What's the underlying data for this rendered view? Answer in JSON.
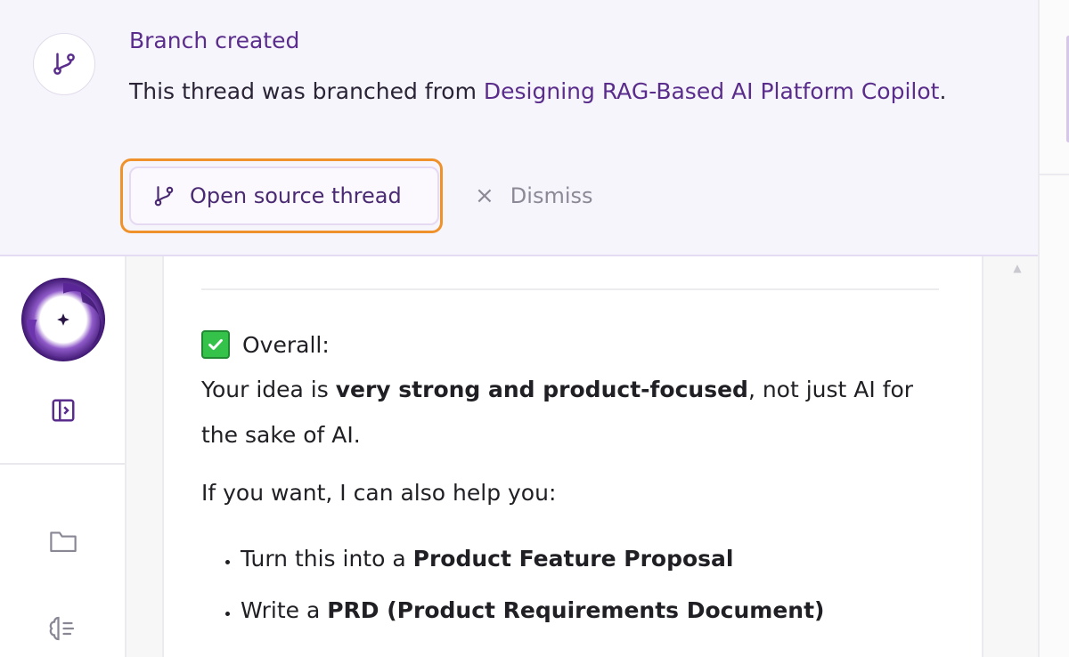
{
  "banner": {
    "title": "Branch created",
    "text_prefix": "This thread was branched from ",
    "source_thread": "Designing RAG-Based AI Platform Copilot",
    "text_suffix": ".",
    "open_button_label": "Open source thread",
    "dismiss_label": "Dismiss",
    "dismiss_icon": "×"
  },
  "sidebar": {
    "icons": [
      "branch-logo",
      "sidebar-toggle-icon",
      "folder-icon",
      "brain-icon"
    ]
  },
  "message": {
    "overall_label": "Overall:",
    "p1_prefix": "Your idea is ",
    "p1_bold": "very strong and product-focused",
    "p1_suffix": ", not just AI for the sake of AI.",
    "p2": "If you want, I can also help you:",
    "bullets": [
      {
        "prefix": "Turn this into a ",
        "bold": "Product Feature Proposal"
      },
      {
        "prefix": "Write a ",
        "bold": "PRD (Product Requirements Document)"
      }
    ]
  },
  "colors": {
    "accent_purple": "#5a2d8c",
    "focus_orange": "#f0922b",
    "check_green": "#34c24b"
  }
}
